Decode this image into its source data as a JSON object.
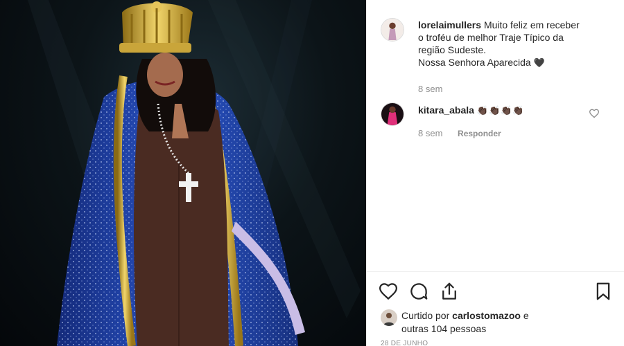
{
  "post": {
    "username": "lorelaimullers",
    "caption_lines": [
      "Muito feliz em receber",
      "o troféu de melhor Traje Típico da",
      "região Sudeste.",
      "Nossa Senhora Aparecida"
    ],
    "caption_heart": "🖤",
    "time": "8 sem"
  },
  "comments": [
    {
      "username": "kitara_abala",
      "text": "👏🏿👏🏿👏🏿👏🏿",
      "time": "8 sem",
      "reply_label": "Responder"
    }
  ],
  "actions": {
    "icons": [
      "heart-icon",
      "comment-icon",
      "share-icon",
      "bookmark-icon"
    ]
  },
  "likes": {
    "prefix": "Curtido por",
    "liked_by": "carlostomazoo",
    "connector": "e",
    "others": "outras 104 pessoas"
  },
  "date": "28 DE JUNHO",
  "colors": {
    "text": "#262626",
    "muted": "#8e8e8e",
    "border": "#efefef",
    "robe_blue": "#1e3c9e",
    "gold": "#d4b13a"
  }
}
